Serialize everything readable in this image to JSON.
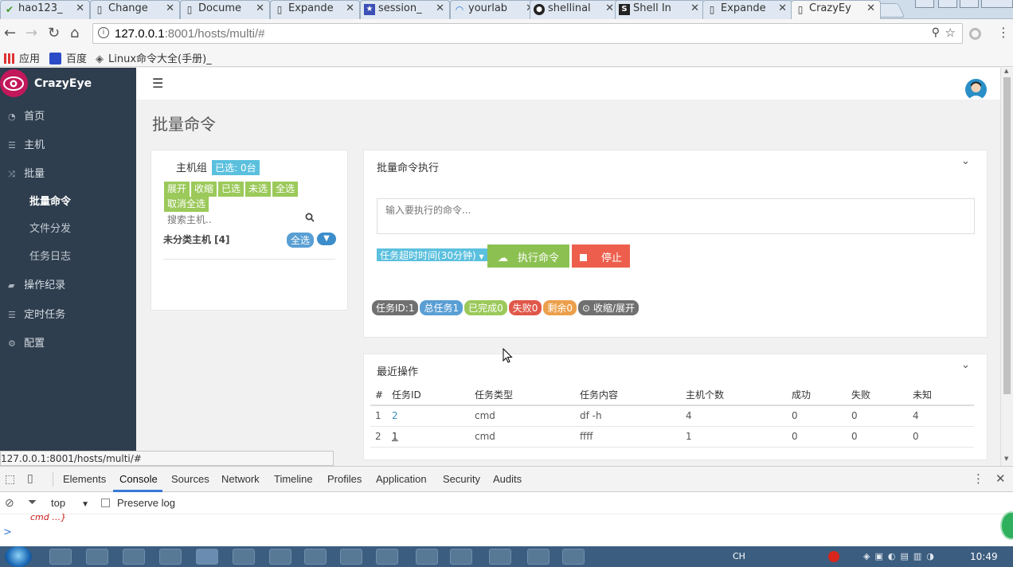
{
  "browser": {
    "tabs": [
      {
        "title": "hao123_",
        "icon": "hao123-icon"
      },
      {
        "title": "Change",
        "icon": "document-icon"
      },
      {
        "title": "Docume",
        "icon": "document-icon"
      },
      {
        "title": "Expande",
        "icon": "document-icon"
      },
      {
        "title": "session_",
        "icon": "app-icon"
      },
      {
        "title": "yourlab",
        "icon": "loading-icon"
      },
      {
        "title": "shellinal",
        "icon": "github-icon"
      },
      {
        "title": "Shell In",
        "icon": "s-icon"
      },
      {
        "title": "Expande",
        "icon": "document-icon"
      },
      {
        "title": "CrazyEy",
        "icon": "document-icon"
      }
    ],
    "url_host": "127.0.0.1",
    "url_rest": ":8001/hosts/multi/#",
    "bookmarks": [
      {
        "label": "应用",
        "icon": "apps-grid-icon"
      },
      {
        "label": "百度",
        "icon": "baidu-icon"
      },
      {
        "label": "Linux命令大全(手册)_",
        "icon": "diamond-icon"
      }
    ],
    "status_url": "127.0.0.1:8001/hosts/multi/#"
  },
  "sidebar": {
    "brand": "CrazyEye",
    "items": [
      {
        "label": "首页",
        "icon": "dashboard-icon"
      },
      {
        "label": "主机",
        "icon": "list-icon"
      },
      {
        "label": "批量",
        "icon": "shuffle-icon"
      },
      {
        "label": "操作纪录",
        "icon": "book-icon"
      },
      {
        "label": "定时任务",
        "icon": "list-icon"
      },
      {
        "label": "配置",
        "icon": "gear-icon"
      }
    ],
    "subitems": [
      {
        "label": "批量命令",
        "active": true
      },
      {
        "label": "文件分发",
        "active": false
      },
      {
        "label": "任务日志",
        "active": false
      }
    ]
  },
  "page": {
    "title": "批量命令"
  },
  "hostpanel": {
    "group_label": "主机组",
    "selected_badge": "已选: 0台",
    "buttons": [
      "展开",
      "收缩",
      "已选",
      "未选",
      "全选",
      "取消全选"
    ],
    "search_placeholder": "搜索主机..",
    "group_name": "未分类主机 [4]",
    "group_select_all": "全选"
  },
  "cmdpanel": {
    "title": "批量命令执行",
    "command_placeholder": "输入要执行的命令...",
    "timeout_label": "任务超时时间(30分钟)",
    "run_label": "执行命令",
    "stop_label": "停止",
    "status": {
      "task_id": "任务ID:1",
      "total": "总任务1",
      "done": "已完成0",
      "failed": "失败0",
      "remaining": "剩余0",
      "toggle": "收缩/展开"
    }
  },
  "recent": {
    "title": "最近操作",
    "columns": [
      "#",
      "任务ID",
      "任务类型",
      "任务内容",
      "主机个数",
      "成功",
      "失败",
      "未知"
    ],
    "rows": [
      [
        "1",
        "2",
        "cmd",
        "df -h",
        "4",
        "0",
        "0",
        "4"
      ],
      [
        "2",
        "1",
        "cmd",
        "ffff",
        "1",
        "0",
        "0",
        "0"
      ]
    ]
  },
  "devtools": {
    "tabs": [
      "Elements",
      "Console",
      "Sources",
      "Network",
      "Timeline",
      "Profiles",
      "Application",
      "Security",
      "Audits"
    ],
    "active_tab": "Console",
    "context": "top",
    "preserve_log": "Preserve log",
    "console_line": "cmd …}",
    "prompt": ">"
  },
  "taskbar": {
    "ime": "CH",
    "clock": "10:49"
  },
  "colors": {
    "sidebar": "#2f3e4e",
    "green": "#9bc95a",
    "blue_badge": "#5bc0de",
    "run_button": "#8cc152",
    "stop_button": "#ed5f4c",
    "timeout_button": "#5bc0de"
  }
}
